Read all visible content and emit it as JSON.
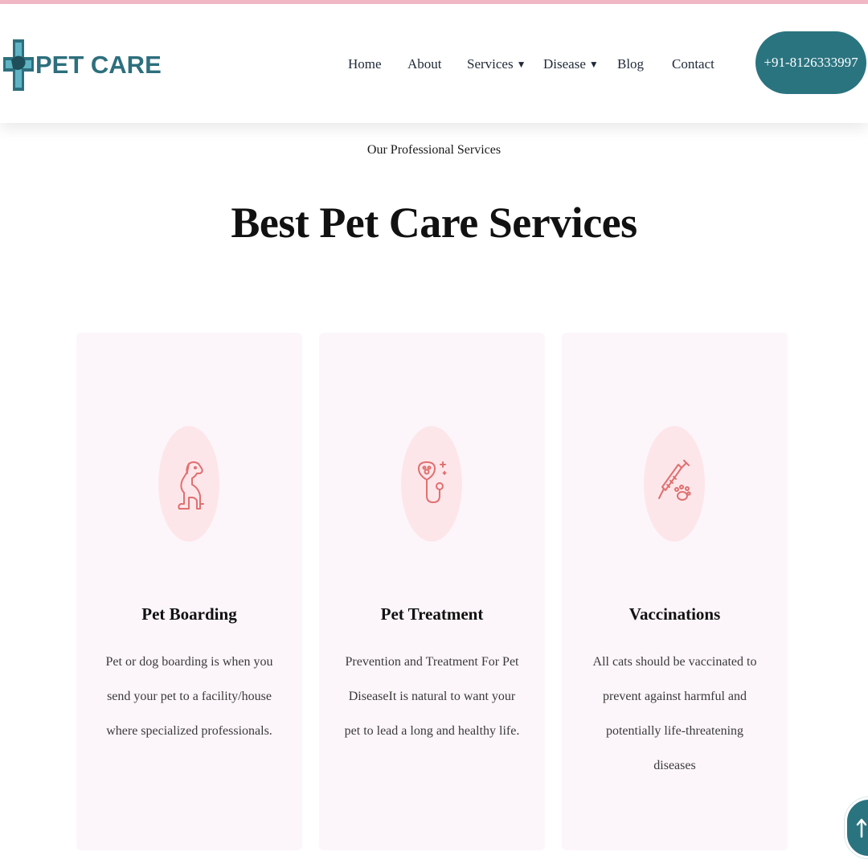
{
  "brand": {
    "name": "PET CARE",
    "color": "#2d6f7d"
  },
  "nav": {
    "items": [
      {
        "label": "Home",
        "dropdown": false
      },
      {
        "label": "About",
        "dropdown": false
      },
      {
        "label": "Services",
        "dropdown": true
      },
      {
        "label": "Disease",
        "dropdown": true
      },
      {
        "label": "Blog",
        "dropdown": false
      },
      {
        "label": "Contact",
        "dropdown": false
      }
    ],
    "caret": "▼",
    "phone": "+91-8126333997"
  },
  "hero": {
    "subtitle": "Our Professional Services",
    "title": "Best Pet Care Services"
  },
  "services": [
    {
      "icon": "dog-icon",
      "title": "Pet Boarding",
      "description": "Pet or dog boarding is when you send your pet to a facility/house where specialized professionals."
    },
    {
      "icon": "stethoscope-paw-icon",
      "title": "Pet Treatment",
      "description": "Prevention and Treatment For Pet DiseaseIt is natural to want your pet to lead a long and healthy life."
    },
    {
      "icon": "syringe-paw-icon",
      "title": "Vaccinations",
      "description": "All cats should be vaccinated to prevent against harmful and potentially life-threatening diseases"
    }
  ],
  "colors": {
    "accent": "#2a7480",
    "card_bg": "#fcf6fb",
    "icon_bg": "#fde6ea",
    "icon_stroke": "#e07070",
    "top_line": "#f2b8c6"
  },
  "scroll_top": {
    "icon": "arrow-up-icon"
  }
}
